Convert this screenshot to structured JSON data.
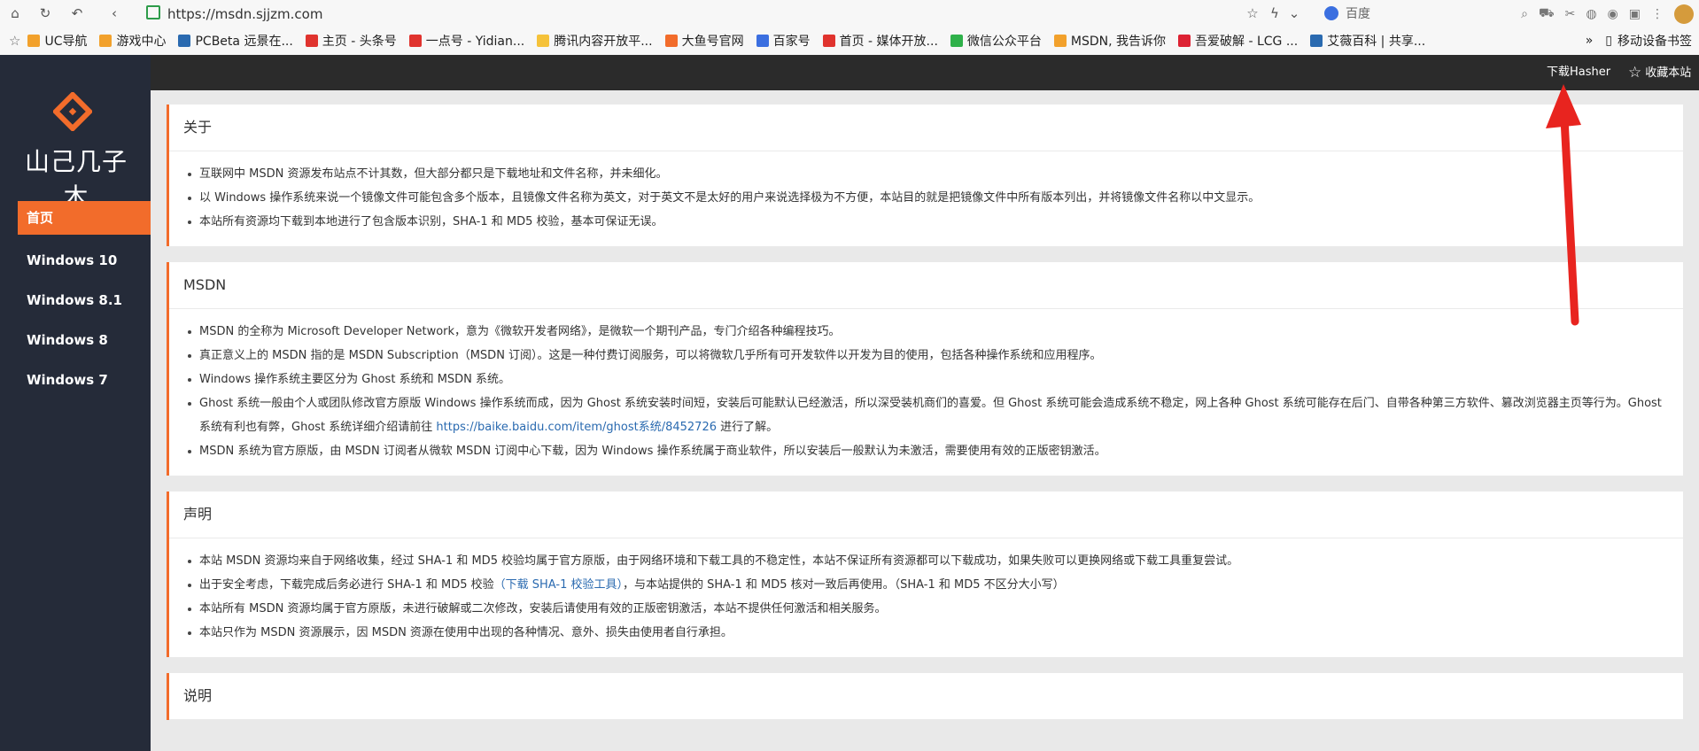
{
  "browser": {
    "url": "https://msdn.sjjzm.com",
    "search_engine": "百度",
    "bookmarks": [
      {
        "label": "UC导航",
        "color": "#f2a12c"
      },
      {
        "label": "游戏中心",
        "color": "#f2a12c"
      },
      {
        "label": "PCBeta 远景在...",
        "color": "#2a6ab0"
      },
      {
        "label": "主页 - 头条号",
        "color": "#e0332e"
      },
      {
        "label": "一点号 - Yidian...",
        "color": "#e0332e"
      },
      {
        "label": "腾讯内容开放平...",
        "color": "#f5c23a"
      },
      {
        "label": "大鱼号官网",
        "color": "#f26c2b"
      },
      {
        "label": "百家号",
        "color": "#3b6fe0"
      },
      {
        "label": "首页 - 媒体开放...",
        "color": "#e0332e"
      },
      {
        "label": "微信公众平台",
        "color": "#2fb14a"
      },
      {
        "label": "MSDN, 我告诉你",
        "color": "#f2a12c"
      },
      {
        "label": "吾爱破解 - LCG ...",
        "color": "#d23"
      },
      {
        "label": "艾薇百科 | 共享...",
        "color": "#2a6ab0"
      }
    ],
    "bookmark_overflow": "»",
    "mobile_bookmarks": "移动设备书签"
  },
  "site": {
    "logo_text": "山己几子木",
    "logo_color": "#f26c2b",
    "menu": [
      {
        "label": "首页",
        "active": true
      },
      {
        "label": "Windows 10",
        "active": false
      },
      {
        "label": "Windows 8.1",
        "active": false
      },
      {
        "label": "Windows 8",
        "active": false
      },
      {
        "label": "Windows 7",
        "active": false
      }
    ],
    "topbar": {
      "download_hasher": "下载Hasher",
      "bookmark_site": "收藏本站"
    }
  },
  "sections": [
    {
      "title": "关于",
      "items": [
        "互联网中 MSDN 资源发布站点不计其数，但大部分都只是下载地址和文件名称，并未细化。",
        "以 Windows 操作系统来说一个镜像文件可能包含多个版本，且镜像文件名称为英文，对于英文不是太好的用户来说选择极为不方便，本站目的就是把镜像文件中所有版本列出，并将镜像文件名称以中文显示。",
        "本站所有资源均下载到本地进行了包含版本识别，SHA-1 和 MD5 校验，基本可保证无误。"
      ]
    },
    {
      "title": "MSDN",
      "items": [
        "MSDN 的全称为 Microsoft Developer Network，意为《微软开发者网络》，是微软一个期刊产品，专门介绍各种编程技巧。",
        "真正意义上的 MSDN 指的是 MSDN Subscription（MSDN 订阅）。这是一种付费订阅服务，可以将微软几乎所有可开发软件以开发为目的使用，包括各种操作系统和应用程序。",
        "Windows 操作系统主要区分为 Ghost 系统和 MSDN 系统。",
        "Ghost 系统一般由个人或团队修改官方原版 Windows 操作系统而成，因为 Ghost 系统安装时间短，安装后可能默认已经激活，所以深受装机商们的喜爱。但 Ghost 系统可能会造成系统不稳定，网上各种 Ghost 系统可能存在后门、自带各种第三方软件、篡改浏览器主页等行为。Ghost 系统有利也有弊，Ghost 系统详细介绍请前往",
        "MSDN 系统为官方原版，由 MSDN 订阅者从微软 MSDN 订阅中心下载，因为 Windows 操作系统属于商业软件，所以安装后一般默认为未激活，需要使用有效的正版密钥激活。"
      ],
      "ghost_link": "https://baike.baidu.com/item/ghost系统/8452726",
      "ghost_suffix": " 进行了解。"
    },
    {
      "title": "声明",
      "items": [
        "本站 MSDN 资源均来自于网络收集，经过 SHA-1 和 MD5 校验均属于官方原版，由于网络环境和下载工具的不稳定性，本站不保证所有资源都可以下载成功，如果失败可以更换网络或下载工具重复尝试。",
        "出于安全考虑，下载完成后务必进行 SHA-1 和 MD5 校验",
        "本站所有 MSDN 资源均属于官方原版，未进行破解或二次修改，安装后请使用有效的正版密钥激活，本站不提供任何激活和相关服务。",
        "本站只作为 MSDN 资源展示，因 MSDN 资源在使用中出现的各种情况、意外、损失由使用者自行承担。"
      ],
      "hash_tool_link": "（下载 SHA-1 校验工具）",
      "hash_suffix": "，与本站提供的 SHA-1 和 MD5 核对一致后再使用。（SHA-1 和 MD5 不区分大小写）"
    },
    {
      "title": "说明",
      "items": []
    }
  ],
  "colors": {
    "accent": "#f26c2b",
    "sidebar_bg": "#252b39",
    "topbar_bg": "#2b2b2b",
    "arrow": "#e8241f",
    "link": "#2a6ab0"
  }
}
